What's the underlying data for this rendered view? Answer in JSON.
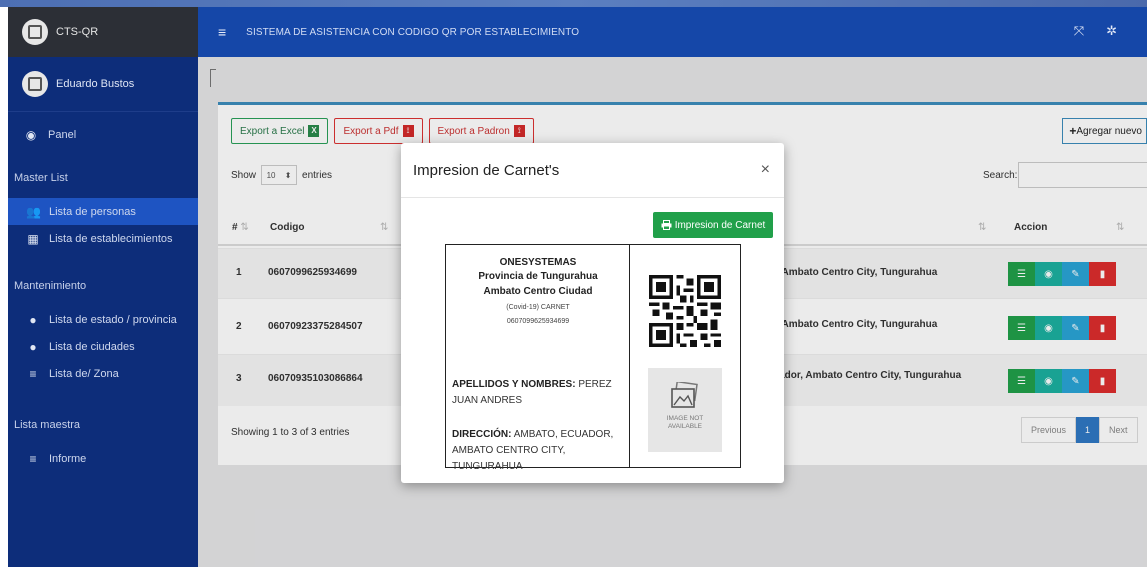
{
  "brand": {
    "title": "CTS-QR"
  },
  "user": {
    "name": "Eduardo Bustos"
  },
  "sidebar": {
    "panel": "Panel",
    "section_master": "Master List",
    "lista_personas": "Lista de personas",
    "lista_establecimientos": "Lista de establecimientos",
    "section_mant": "Mantenimiento",
    "lista_estado": "Lista de estado / provincia",
    "lista_ciudades": "Lista de ciudades",
    "lista_zona": "Lista de/ Zona",
    "section_maestra": "Lista maestra",
    "informe": "Informe"
  },
  "header": {
    "title": "SISTEMA DE ASISTENCIA CON CODIGO QR POR ESTABLECIMIENTO"
  },
  "toolbar": {
    "excel": "Export a Excel",
    "pdf": "Export a Pdf",
    "padron": "Export a Padron",
    "add": "Agregar nuevo"
  },
  "table": {
    "show": "Show",
    "entries_value": "10",
    "entries": "entries",
    "search": "Search:",
    "col_num": "#",
    "col_codigo": "Codigo",
    "col_accion": "Accion",
    "rows": [
      {
        "num": "1",
        "codigo": "0607099625934699",
        "addr": "r, Ambato Centro City, Tungurahua"
      },
      {
        "num": "2",
        "codigo": "06070923375284507",
        "addr": "r, Ambato Centro City, Tungurahua"
      },
      {
        "num": "3",
        "codigo": "06070935103086864",
        "addr": "uador, Ambato Centro City, Tungurahua"
      }
    ],
    "showing": "Showing 1 to 3 of 3 entries",
    "prev": "Previous",
    "page": "1",
    "next": "Next"
  },
  "modal": {
    "title": "Impresion de Carnet's",
    "close": "×",
    "print": "Impresion de Carnet"
  },
  "card": {
    "org": "ONESYSTEMAS",
    "province": "Provincia de Tungurahua",
    "city": "Ambato Centro Ciudad",
    "type": "(Covid-19) CARNET",
    "code": "0607099625934699",
    "names_label": "APELLIDOS Y NOMBRES:",
    "names_value": "PEREZ JUAN ANDRES",
    "addr_label": "DIRECCIÓN:",
    "addr_value": "AMBATO, ECUADOR, AMBATO CENTRO CITY, TUNGURAHUA",
    "photo_text_1": "IMAGE NOT",
    "photo_text_2": "AVAILABLE"
  }
}
